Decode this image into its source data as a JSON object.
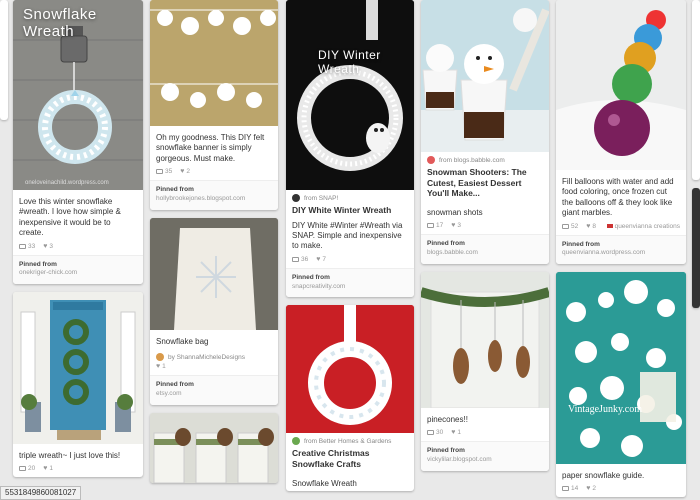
{
  "pins": {
    "p1": {
      "overlay": "Snowflake Wreath",
      "watermark": "oneloveinachild.wordpress.com",
      "caption": "Love this winter snowflake #wreath. I love how simple & inexpensive it would be to create.",
      "repins": "33",
      "likes": "3",
      "source_label": "Pinned from",
      "source_url": "onekriger-chick.com"
    },
    "p2": {
      "caption": "Oh my goodness. This DIY felt snowflake banner is simply gorgeous. Must make.",
      "repins": "35",
      "likes": "2",
      "source_label": "Pinned from",
      "source_url": "hollybrookejones.blogspot.com"
    },
    "p3": {
      "overlay": "DIY Winter Wreath",
      "via": "from SNAP!",
      "title": "DIY White Winter Wreath",
      "caption": "DIY White #Winter #Wreath via SNAP. Simple and inexpensive to make.",
      "repins": "36",
      "likes": "7",
      "source_label": "Pinned from",
      "source_url": "snapcreativity.com"
    },
    "p4": {
      "via": "from blogs.babble.com",
      "title": "Snowman Shooters: The Cutest, Easiest Dessert You'll Make...",
      "caption": "snowman shots",
      "repins": "17",
      "likes": "3",
      "source_label": "Pinned from",
      "source_url": "blogs.babble.com"
    },
    "p5": {
      "caption": "Fill balloons with water and add food coloring, once frozen cut the balloons off & they look like giant marbles.",
      "repins": "52",
      "likes": "8",
      "by": "queenvianna creations",
      "source_label": "Pinned from",
      "source_url": "queenvianna.wordpress.com"
    },
    "p6": {
      "caption": "Snowflake bag",
      "by": "by ShannaMicheleDesigns",
      "likes": "1",
      "source_label": "Pinned from",
      "source_url": "etsy.com"
    },
    "p7": {
      "caption": "triple wreath~ I just love this!",
      "repins": "20",
      "likes": "1"
    },
    "p8": {
      "caption": "pinecones!!",
      "repins": "30",
      "likes": "1",
      "source_label": "Pinned from",
      "source_url": "vickylilar.blogspot.com"
    },
    "p9": {
      "via": "from Better Homes & Gardens",
      "title": "Creative Christmas Snowflake Crafts",
      "caption": "Snowflake Wreath"
    },
    "p10": {
      "watermark": "VintageJunky.com",
      "caption": "paper snowflake guide.",
      "repins": "14",
      "likes": "2"
    }
  },
  "status_url": "5531849860081027",
  "colors": {
    "pin_red": "#cb2027",
    "background": "#e9e9e9",
    "teal": "#2a9a95",
    "door_blue": "#3f8fb5"
  }
}
